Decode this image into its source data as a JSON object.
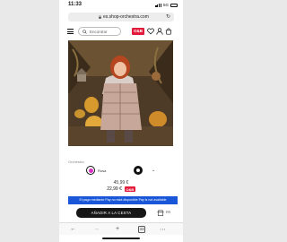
{
  "status": {
    "time": "11:33",
    "network": "5G",
    "battery": ""
  },
  "browser": {
    "url": "es.shop-orchestra.com",
    "back_icon": "arrow-left-icon",
    "forward_icon": "arrow-right-icon",
    "tabs_count": "33"
  },
  "header": {
    "search_placeholder": "Encontrar",
    "logo_text": "O&B"
  },
  "product": {
    "brand": "Orchestra",
    "colors": [
      {
        "name": "Rosa",
        "hex": "#d930c4",
        "selected": true
      },
      {
        "name": "",
        "hex": "#111111",
        "selected": false
      }
    ],
    "price_original": "45,99 €",
    "price_sale": "22,99 €",
    "price_badge": "O&B"
  },
  "payment_banner": "El pago mediante  Pay no está disponible  Pay is not available",
  "add_to_cart_label": "AÑADIR A LA CESTA",
  "store_label": "FR"
}
